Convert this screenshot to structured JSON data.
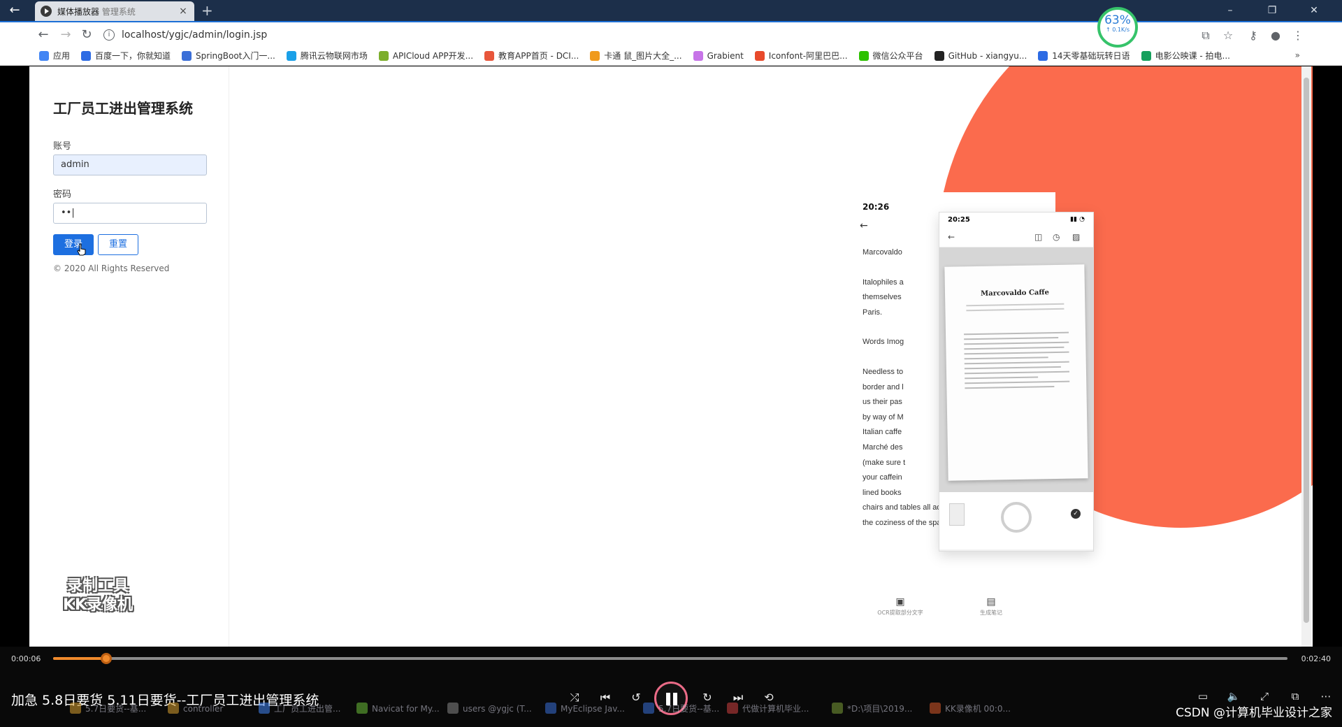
{
  "browser": {
    "tab_title": "媒体播放器",
    "tab_subtitle": "管理系统",
    "tab_close": "×",
    "new_tab": "+",
    "url": "localhost/ygjc/admin/login.jsp",
    "speed_percent": "63%",
    "speed_rate": "↑ 0.1K/s",
    "bookmarks": [
      {
        "label": "应用",
        "color": "#4285f4"
      },
      {
        "label": "百度一下，你就知道",
        "color": "#2d6be4"
      },
      {
        "label": "SpringBoot入门一...",
        "color": "#3b6fd8"
      },
      {
        "label": "腾讯云物联网市场",
        "color": "#1aa0e8"
      },
      {
        "label": "APICloud APP开发...",
        "color": "#7cae2c"
      },
      {
        "label": "教育APP首页 - DCI...",
        "color": "#e8563b"
      },
      {
        "label": "卡通 鼠_图片大全_...",
        "color": "#f09a1c"
      },
      {
        "label": "Grabient",
        "color": "#c774e8"
      },
      {
        "label": "Iconfont-阿里巴巴...",
        "color": "#e84a2b"
      },
      {
        "label": "微信公众平台",
        "color": "#2dc100"
      },
      {
        "label": "GitHub - xiangyu...",
        "color": "#222222"
      },
      {
        "label": "14天零基础玩转日语",
        "color": "#2d6be4"
      },
      {
        "label": "电影公映课 - 拍电...",
        "color": "#16a05d"
      }
    ],
    "bookmarks_more": "»"
  },
  "login": {
    "title": "工厂员工进出管理系统",
    "account_label": "账号",
    "account_value": "admin",
    "password_label": "密码",
    "password_value": "••|",
    "login_button": "登录",
    "reset_button": "重置",
    "copyright": "© 2020 All Rights Reserved"
  },
  "watermark": {
    "line1": "录制工具",
    "line2": "KK录像机"
  },
  "showcase": {
    "article_time": "20:26",
    "article_lines": [
      "Marcovaldo",
      "Italophiles a",
      "themselves",
      "Paris.",
      "Words Imog",
      "Needless to",
      "border and l",
      "us their pas",
      "by way of M",
      "Italian caffe",
      "Marché des",
      "(make sure t",
      "your caffein",
      "lined books",
      "chairs and tables all add to",
      "the coziness of the space. Free Wi-Fi is an"
    ],
    "phone_time": "20:25",
    "doc_title": "Marcovaldo Caffe",
    "tool_ocr": "OCR提取部分文字",
    "tool_note": "生成笔记"
  },
  "player": {
    "current_time": "0:00:06",
    "total_time": "0:02:40",
    "progress_fraction": 0.043,
    "caption": "加急 5.8日要货 5.11日要货--工厂员工进出管理系统",
    "accent": "#f08a2c"
  },
  "taskbar": {
    "items": [
      "5.7日要货--基...",
      "controller",
      "工厂员工进出管...",
      "Navicat for My...",
      "users @ygjc (T...",
      "MyEclipse Jav...",
      "5.7日要货--基...",
      "代做计算机毕业...",
      "*D:\\项目\\2019...",
      "KK录像机 00:0..."
    ]
  },
  "credit": "CSDN @计算机毕业设计之家"
}
